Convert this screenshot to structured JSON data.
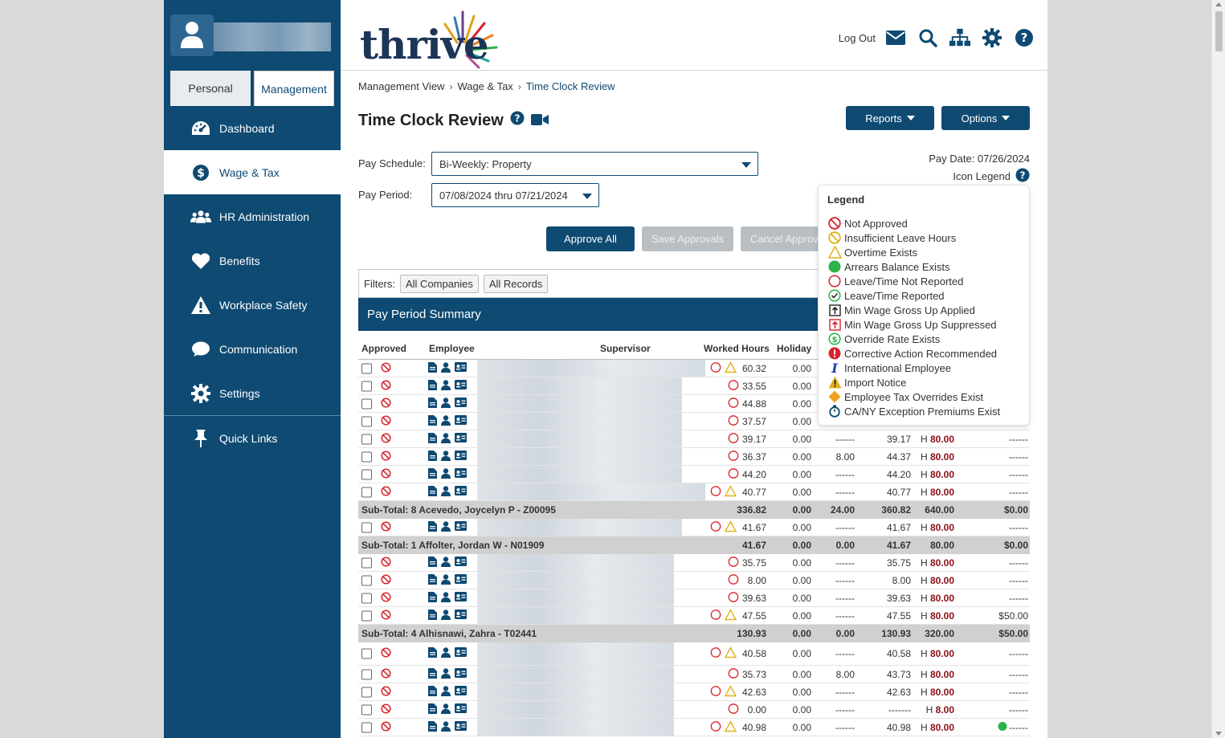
{
  "sidebar": {
    "tabs": {
      "personal": "Personal",
      "management": "Management"
    },
    "items": [
      {
        "label": "Dashboard",
        "icon": "dashboard-icon"
      },
      {
        "label": "Wage & Tax",
        "icon": "dollar-icon",
        "active": true
      },
      {
        "label": "HR Administration",
        "icon": "users-icon"
      },
      {
        "label": "Benefits",
        "icon": "heart-icon"
      },
      {
        "label": "Workplace Safety",
        "icon": "warning-icon"
      },
      {
        "label": "Communication",
        "icon": "chat-icon"
      },
      {
        "label": "Settings",
        "icon": "gear-icon"
      }
    ],
    "quick_links": "Quick Links"
  },
  "header": {
    "logo": "thrive",
    "logout": "Log Out"
  },
  "breadcrumb": [
    "Management View",
    "Wage & Tax",
    "Time Clock Review"
  ],
  "page": {
    "title": "Time Clock Review",
    "reports": "Reports",
    "options": "Options",
    "pay_date": "Pay Date: 07/26/2024",
    "icon_legend": "Icon Legend",
    "pay_schedule_label": "Pay Schedule:",
    "pay_schedule_value": "Bi-Weekly: Property",
    "pay_period_label": "Pay Period:",
    "pay_period_value": "07/08/2024 thru 07/21/2024",
    "approve_all": "Approve All",
    "save_approvals": "Save Approvals",
    "cancel_approvals": "Cancel Approv",
    "filters_label": "Filters:",
    "filter_companies": "All Companies",
    "filter_records": "All Records",
    "summary_title": "Pay Period Summary"
  },
  "table": {
    "headers": {
      "approved": "Approved",
      "employee": "Employee",
      "supervisor": "Supervisor",
      "worked": "Worked Hours",
      "holiday": "Holiday"
    },
    "rows": [
      {
        "type": "emp",
        "worked": "60.32",
        "holiday": "0.00",
        "pto": "",
        "total": "",
        "h": "",
        "extra": "",
        "tri": true,
        "blurw": 284
      },
      {
        "type": "emp",
        "worked": "33.55",
        "holiday": "0.00",
        "pto": "",
        "total": "",
        "h": "",
        "extra": "",
        "blurw": 255
      },
      {
        "type": "emp",
        "worked": "44.88",
        "holiday": "0.00",
        "pto": "",
        "total": "",
        "h": "",
        "extra": "",
        "blurw": 255
      },
      {
        "type": "emp",
        "worked": "37.57",
        "holiday": "0.00",
        "pto": "",
        "total": "",
        "h": "",
        "extra": "",
        "blurw": 255
      },
      {
        "type": "emp",
        "worked": "39.17",
        "holiday": "0.00",
        "pto": "------",
        "total": "39.17",
        "h": "80.00",
        "extra": "------",
        "blurw": 255
      },
      {
        "type": "emp",
        "worked": "36.37",
        "holiday": "0.00",
        "pto": "8.00",
        "total": "44.37",
        "h": "80.00",
        "extra": "------",
        "blurw": 255
      },
      {
        "type": "emp",
        "worked": "44.20",
        "holiday": "0.00",
        "pto": "------",
        "total": "44.20",
        "h": "80.00",
        "extra": "------",
        "blurw": 255
      },
      {
        "type": "emp",
        "worked": "40.77",
        "holiday": "0.00",
        "pto": "------",
        "total": "40.77",
        "h": "80.00",
        "extra": "------",
        "tri": true,
        "blurw": 284
      },
      {
        "type": "sub",
        "label": "Sub-Total: 8 Acevedo, Joycelyn P - Z00095",
        "worked": "336.82",
        "holiday": "0.00",
        "pto": "24.00",
        "total": "360.82",
        "h": "640.00",
        "extra": "$0.00"
      },
      {
        "type": "emp",
        "worked": "41.67",
        "holiday": "0.00",
        "pto": "------",
        "total": "41.67",
        "h": "80.00",
        "extra": "------",
        "tri": true,
        "blurw": 255
      },
      {
        "type": "sub",
        "label": "Sub-Total: 1 Affolter, Jordan W - N01909",
        "worked": "41.67",
        "holiday": "0.00",
        "pto": "0.00",
        "total": "41.67",
        "h": "80.00",
        "extra": "$0.00"
      },
      {
        "type": "emp",
        "worked": "35.75",
        "holiday": "0.00",
        "pto": "------",
        "total": "35.75",
        "h": "80.00",
        "extra": "------",
        "blurw": 245
      },
      {
        "type": "emp",
        "worked": "8.00",
        "holiday": "0.00",
        "pto": "------",
        "total": "8.00",
        "h": "80.00",
        "extra": "------",
        "blurw": 245
      },
      {
        "type": "emp",
        "worked": "39.63",
        "holiday": "0.00",
        "pto": "------",
        "total": "39.63",
        "h": "80.00",
        "extra": "------",
        "blurw": 245
      },
      {
        "type": "emp",
        "worked": "47.55",
        "holiday": "0.00",
        "pto": "------",
        "total": "47.55",
        "h": "80.00",
        "extra": "$50.00",
        "tri": true,
        "blurw": 245
      },
      {
        "type": "sub",
        "label": "Sub-Total: 4 Alhisnawi, Zahra - T02441",
        "worked": "130.93",
        "holiday": "0.00",
        "pto": "0.00",
        "total": "130.93",
        "h": "320.00",
        "extra": "$50.00"
      },
      {
        "type": "emp",
        "tall": true,
        "worked": "40.58",
        "holiday": "0.00",
        "pto": "------",
        "total": "40.58",
        "h": "80.00",
        "extra": "------",
        "tri": true,
        "blurw": 245
      },
      {
        "type": "emp",
        "worked": "35.73",
        "holiday": "0.00",
        "pto": "8.00",
        "total": "43.73",
        "h": "80.00",
        "extra": "------",
        "blurw": 245
      },
      {
        "type": "emp",
        "worked": "42.63",
        "holiday": "0.00",
        "pto": "------",
        "total": "42.63",
        "h": "80.00",
        "extra": "------",
        "tri": true,
        "blurw": 245
      },
      {
        "type": "emp",
        "worked": "0.00",
        "holiday": "0.00",
        "pto": "------",
        "total": "-------",
        "h": "8.00",
        "extra": "------",
        "blurw": 245
      },
      {
        "type": "emp",
        "worked": "40.98",
        "holiday": "0.00",
        "pto": "------",
        "total": "40.98",
        "h": "80.00",
        "extra": "------",
        "tri": true,
        "green": true,
        "blurw": 245
      }
    ]
  },
  "legend": {
    "title": "Legend",
    "items": [
      {
        "label": "Not Approved",
        "icon": "not-approved-icon"
      },
      {
        "label": "Insufficient Leave Hours",
        "icon": "insufficient-leave-icon"
      },
      {
        "label": "Overtime Exists",
        "icon": "overtime-icon"
      },
      {
        "label": "Arrears Balance Exists",
        "icon": "arrears-icon"
      },
      {
        "label": "Leave/Time Not Reported",
        "icon": "not-reported-icon"
      },
      {
        "label": "Leave/Time Reported",
        "icon": "reported-icon"
      },
      {
        "label": "Min Wage Gross Up Applied",
        "icon": "min-wage-applied-icon"
      },
      {
        "label": "Min Wage Gross Up Suppressed",
        "icon": "min-wage-suppressed-icon"
      },
      {
        "label": "Override Rate Exists",
        "icon": "override-rate-icon"
      },
      {
        "label": "Corrective Action Recommended",
        "icon": "corrective-action-icon"
      },
      {
        "label": "International Employee",
        "icon": "international-icon"
      },
      {
        "label": "Import Notice",
        "icon": "import-notice-icon"
      },
      {
        "label": "Employee Tax Overrides Exist",
        "icon": "tax-override-icon"
      },
      {
        "label": "CA/NY Exception Premiums Exist",
        "icon": "exception-premium-icon"
      }
    ]
  },
  "colors": {
    "brand": "#0e4a72",
    "alert": "#d9232d",
    "warning": "#e2b11a",
    "green": "#2cb34a"
  }
}
